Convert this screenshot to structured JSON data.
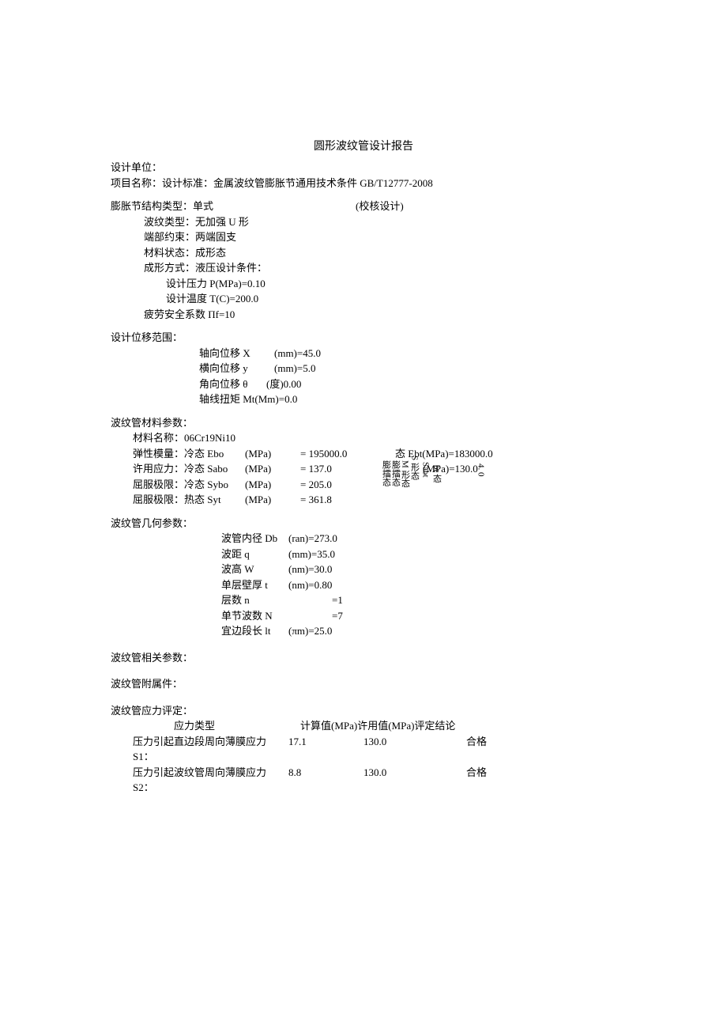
{
  "title": "圆形波纹管设计报告",
  "header": {
    "design_unit_label": "设计单位：",
    "project_label": "项目名称：设计标准：金属波纹管膨胀节通用技术条件 GB/T12777-2008"
  },
  "structure": {
    "line1_left": "膨胀节结构类型：单式",
    "line1_right": "(校核设计)",
    "wave_type": "波纹类型：无加强 U 形",
    "end_constraint": "端部约束：两端固支",
    "material_state": "材料状态：成形态",
    "forming_method": "成形方式：液压设计条件：",
    "cond_pressure": "设计压力 P(MPa)=0.10",
    "cond_temp": "设计温度 T(C)=200.0",
    "fatigue": "疲劳安全系数 Πf=10"
  },
  "displacement": {
    "header": "设计位移范围：",
    "x_label": "轴向位移 X",
    "x_unit": "(mm)=45.0",
    "y_label": "横向位移 y",
    "y_unit": "(mm)=5.0",
    "theta_label": "角向位移 θ",
    "theta_unit": "(度)0.00",
    "mt_label": "轴线扭矩 Mt(Mm)=0.0"
  },
  "material": {
    "header": "波纹管材料参数：",
    "name": "材料名称：06Cr19Ni10",
    "ebo_label": "弹性模量：冷态 Ebo",
    "ebo_unit": "(MPa)",
    "ebo_val": "= 195000.0",
    "ebt_right": "态 Ebt(MPa)=183000.0",
    "sabo_label": "许用应力：冷态 Sabo",
    "sabo_unit": "(MPa)",
    "sabo_val": "= 137.0",
    "sabt_right": "(MPa)=130.0",
    "sybo_label": "屈服极限：冷态 Sybo",
    "sybo_unit": "(MPa)",
    "sybo_val": "= 205.0",
    "syt_label": "屈服极限：热态 Syt",
    "syt_unit": "(MPa)",
    "syt_val": "= 361.8",
    "garble1": "膨擂态",
    "garble2": "膨擂态",
    "garble3": "M 形态",
    "garble4": "S 形态",
    "garble5": "Sabt",
    "garble6": "bt 态",
    "garble7": "4. 0"
  },
  "geometry": {
    "header": "波纹管几何参数：",
    "db_label": "波管内径 Db",
    "db_val": "(ran)=273.0",
    "q_label": "波距 q",
    "q_val": "(mm)=35.0",
    "w_label": "波高 W",
    "w_val": "(nm)=30.0",
    "t_label": "单层壁厚 t",
    "t_val": "(nm)=0.80",
    "n_label": "层数 n",
    "n_val": "=1",
    "nw_label": "单节波数 N",
    "nw_val": "=7",
    "lt_label": "宜边段长 lt",
    "lt_val": "(πm)=25.0"
  },
  "related": {
    "header": "波纹管相关参数："
  },
  "attach": {
    "header": "波纹管附属件："
  },
  "stress": {
    "header": "波纹管应力评定：",
    "col_type": "应力类型",
    "col_calc": "计算值(MPa)许用值(MPa)评定结论",
    "r1_label": "压力引起直边段周向薄膜应力 S1：",
    "r1_calc": "17.1",
    "r1_allow": "130.0",
    "r1_res": "合格",
    "r2_label": "压力引起波纹管周向薄膜应力 S2：",
    "r2_calc": "8.8",
    "r2_allow": "130.0",
    "r2_res": "合格"
  }
}
